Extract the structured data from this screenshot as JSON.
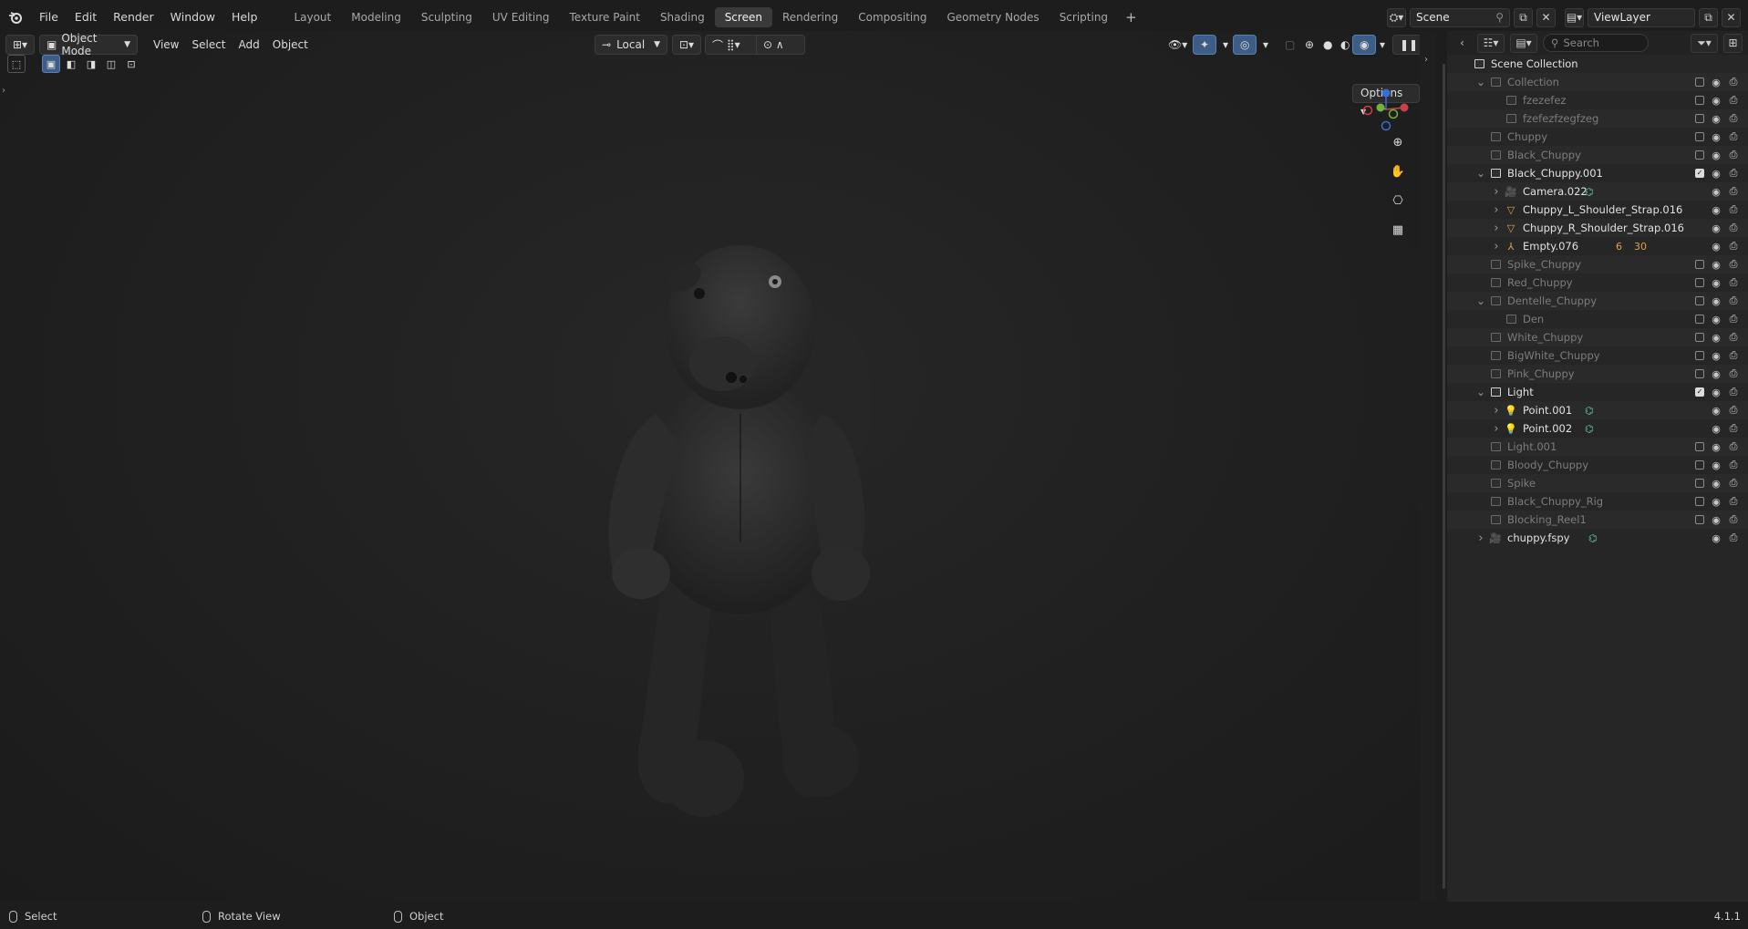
{
  "menu": {
    "file": "File",
    "edit": "Edit",
    "render": "Render",
    "window": "Window",
    "help": "Help"
  },
  "workspaces": [
    "Layout",
    "Modeling",
    "Sculpting",
    "UV Editing",
    "Texture Paint",
    "Shading",
    "Screen",
    "Rendering",
    "Compositing",
    "Geometry Nodes",
    "Scripting"
  ],
  "active_workspace": "Screen",
  "scene": {
    "name": "Scene",
    "view_layer": "ViewLayer"
  },
  "viewport": {
    "mode": "Object Mode",
    "view": "View",
    "select": "Select",
    "add": "Add",
    "object": "Object",
    "transform_orientation": "Local",
    "options": "Options"
  },
  "outliner": {
    "search_placeholder": "Search",
    "root": "Scene Collection",
    "rows": [
      {
        "name": "Collection",
        "arrow": "v",
        "enabled": false,
        "checkbox": true,
        "checked": false
      },
      {
        "name": "fzezefez",
        "enabled": false,
        "checkbox": true,
        "checked": false
      },
      {
        "name": "fzefezfzegfzeg",
        "enabled": false,
        "checkbox": true,
        "checked": false
      },
      {
        "name": "Chuppy",
        "enabled": false,
        "checkbox": true,
        "checked": false
      },
      {
        "name": "Black_Chuppy",
        "enabled": false,
        "checkbox": true,
        "checked": false
      },
      {
        "name": "Black_Chuppy.001",
        "arrow": "v",
        "enabled": true,
        "checkbox": true,
        "checked": true
      },
      {
        "name": "Camera.022",
        "arrow": ">",
        "enabled": true,
        "type": "camera"
      },
      {
        "name": "Chuppy_L_Shoulder_Strap.016",
        "arrow": ">",
        "enabled": true,
        "type": "mesh"
      },
      {
        "name": "Chuppy_R_Shoulder_Strap.016",
        "arrow": ">",
        "enabled": true,
        "type": "mesh"
      },
      {
        "name": "Empty.076",
        "arrow": ">",
        "enabled": true,
        "type": "empty",
        "badges": [
          "6",
          "30"
        ]
      },
      {
        "name": "Spike_Chuppy",
        "enabled": false,
        "checkbox": true,
        "checked": false
      },
      {
        "name": "Red_Chuppy",
        "enabled": false,
        "checkbox": true,
        "checked": false
      },
      {
        "name": "Dentelle_Chuppy",
        "arrow": "v",
        "enabled": false,
        "checkbox": true,
        "checked": false
      },
      {
        "name": "Den",
        "enabled": false,
        "checkbox": true,
        "checked": false
      },
      {
        "name": "White_Chuppy",
        "enabled": false,
        "checkbox": true,
        "checked": false
      },
      {
        "name": "BigWhite_Chuppy",
        "enabled": false,
        "checkbox": true,
        "checked": false
      },
      {
        "name": "Pink_Chuppy",
        "enabled": false,
        "checkbox": true,
        "checked": false
      },
      {
        "name": "Light",
        "arrow": "v",
        "enabled": true,
        "checkbox": true,
        "checked": true
      },
      {
        "name": "Point.001",
        "arrow": ">",
        "enabled": true,
        "type": "light"
      },
      {
        "name": "Point.002",
        "arrow": ">",
        "enabled": true,
        "type": "light"
      },
      {
        "name": "Light.001",
        "enabled": false,
        "checkbox": true,
        "checked": false
      },
      {
        "name": "Bloody_Chuppy",
        "enabled": false,
        "checkbox": true,
        "checked": false
      },
      {
        "name": "Spike",
        "enabled": false,
        "checkbox": true,
        "checked": false
      },
      {
        "name": "Black_Chuppy_Rig",
        "enabled": false,
        "checkbox": true,
        "checked": false
      },
      {
        "name": "Blocking_Reel1",
        "enabled": false,
        "checkbox": true,
        "checked": false
      },
      {
        "name": "chuppy.fspy",
        "arrow": ">",
        "enabled": true,
        "type": "camera"
      }
    ]
  },
  "statusbar": {
    "select": "Select",
    "rotate": "Rotate View",
    "object": "Object",
    "version": "4.1.1"
  },
  "colors": {
    "accent": "#4772b3",
    "object_orange": "#e0a050",
    "data_green": "#5fc69a"
  }
}
